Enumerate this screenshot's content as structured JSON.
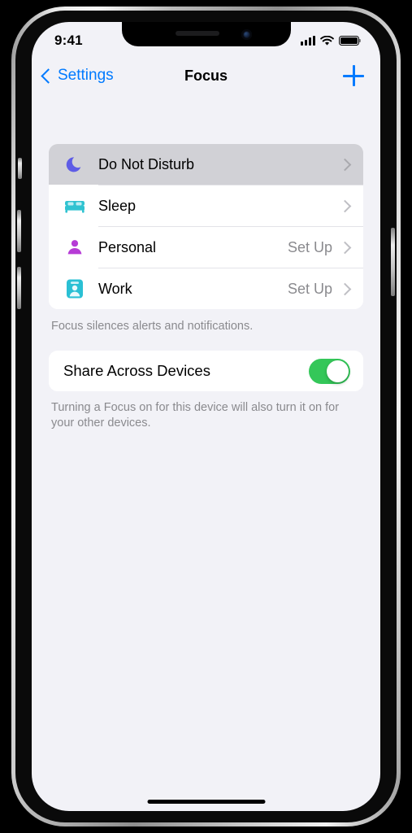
{
  "status_bar": {
    "time": "9:41",
    "cellular_icon": "signal-bars-icon",
    "wifi_icon": "wifi-icon",
    "battery_icon": "battery-full-icon"
  },
  "nav_bar": {
    "back_label": "Settings",
    "back_icon": "chevron-left-icon",
    "title": "Focus",
    "add_icon": "plus-icon"
  },
  "focus_group": {
    "rows": [
      {
        "label": "Do Not Disturb",
        "icon": "moon-icon",
        "icon_color": "#5E5CE6",
        "value": "",
        "selected": true,
        "accessory": "chevron-right-icon"
      },
      {
        "label": "Sleep",
        "icon": "bed-icon",
        "icon_color": "#30C3D1",
        "value": "",
        "selected": false,
        "accessory": "chevron-right-icon"
      },
      {
        "label": "Personal",
        "icon": "person-icon",
        "icon_color": "#B63BD6",
        "value": "Set Up",
        "selected": false,
        "accessory": "chevron-right-icon"
      },
      {
        "label": "Work",
        "icon": "id-badge-icon",
        "icon_color": "#2AC0D4",
        "value": "Set Up",
        "selected": false,
        "accessory": "chevron-right-icon"
      }
    ],
    "footer": "Focus silences alerts and notifications."
  },
  "share_group": {
    "label": "Share Across Devices",
    "toggle_on": true,
    "toggle_color": "#34C759",
    "footer": "Turning a Focus on for this device will also turn it on for your other devices."
  },
  "home_indicator": "home-indicator"
}
